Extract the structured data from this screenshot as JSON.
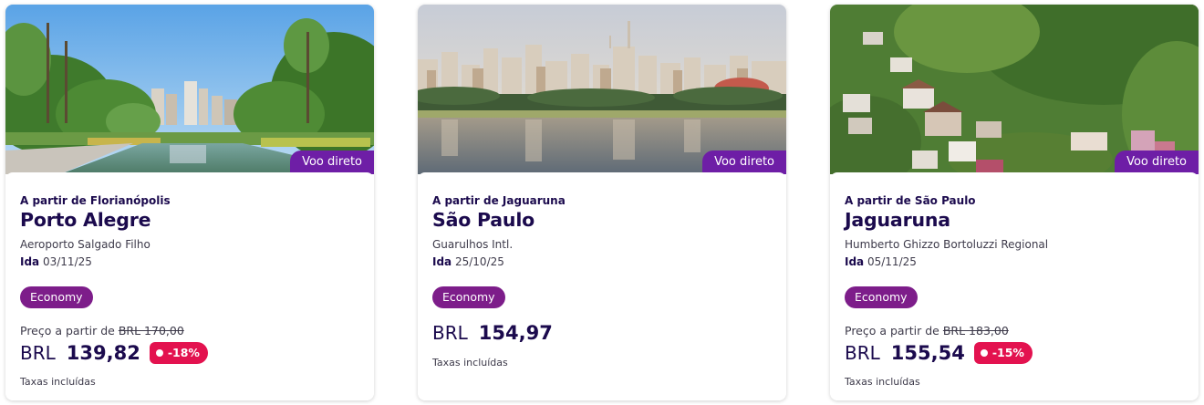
{
  "cards": [
    {
      "image_alt": "Parque Farroupilha, Porto Alegre",
      "badge": "Voo direto",
      "origin": "A partir de Florianópolis",
      "destination": "Porto Alegre",
      "airport": "Aeroporto Salgado Filho",
      "date_label": "Ida",
      "date": "03/11/25",
      "cabin": "Economy",
      "from_label": "Preço a partir de",
      "old_price": "BRL 170,00",
      "currency": "BRL",
      "price": "139,82",
      "discount": "-18%",
      "taxes": "Taxas incluídas"
    },
    {
      "image_alt": "Parque Ibirapuera, São Paulo",
      "badge": "Voo direto",
      "origin": "A partir de Jaguaruna",
      "destination": "São Paulo",
      "airport": "Guarulhos Intl.",
      "date_label": "Ida",
      "date": "25/10/25",
      "cabin": "Economy",
      "currency": "BRL",
      "price": "154,97",
      "taxes": "Taxas incluídas"
    },
    {
      "image_alt": "Jaguaruna hillside houses",
      "badge": "Voo direto",
      "origin": "A partir de São Paulo",
      "destination": "Jaguaruna",
      "airport": "Humberto Ghizzo Bortoluzzi Regional",
      "date_label": "Ida",
      "date": "05/11/25",
      "cabin": "Economy",
      "from_label": "Preço a partir de",
      "old_price": "BRL 183,00",
      "currency": "BRL",
      "price": "155,54",
      "discount": "-15%",
      "taxes": "Taxas incluídas"
    }
  ],
  "colors": {
    "brand_purple": "#6e1ea6",
    "cabin_pill": "#7d1d8a",
    "discount_red": "#e3124f",
    "text_navy": "#1b0a4d"
  }
}
